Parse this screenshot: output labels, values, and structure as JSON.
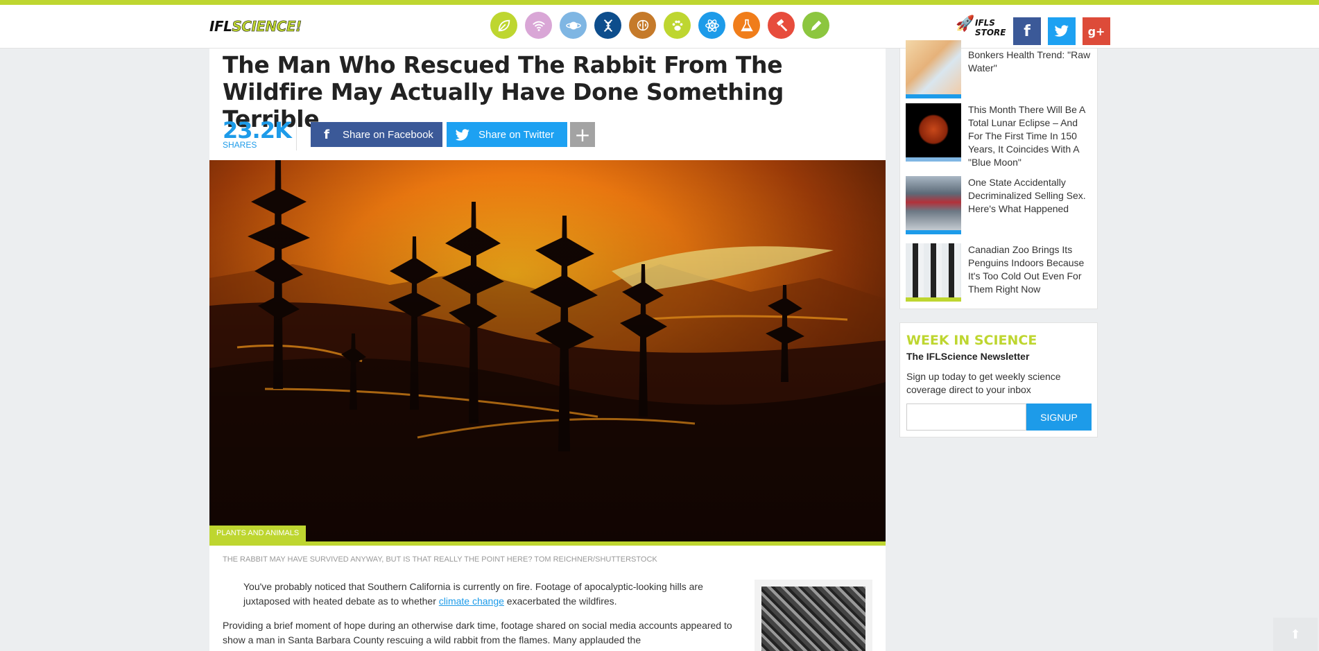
{
  "header": {
    "logo_part1": "IFL",
    "logo_part2": "SCIENCE!",
    "categories": [
      {
        "icon": "leaf-icon",
        "color": "#bed630"
      },
      {
        "icon": "wifi-icon",
        "color": "#d9a6d6"
      },
      {
        "icon": "planet-icon",
        "color": "#7fb6e3"
      },
      {
        "icon": "dna-icon",
        "color": "#0d4d8c"
      },
      {
        "icon": "brain-icon",
        "color": "#c57a2a"
      },
      {
        "icon": "paw-icon",
        "color": "#bed630"
      },
      {
        "icon": "atom-icon",
        "color": "#1d9be9"
      },
      {
        "icon": "flask-icon",
        "color": "#f07d1a"
      },
      {
        "icon": "gavel-icon",
        "color": "#e74c3c"
      },
      {
        "icon": "pencil-icon",
        "color": "#8cc63f"
      }
    ],
    "store_line1": "IFLS",
    "store_line2": "STORE",
    "facebook_glyph": "f",
    "googleplus_glyph": "g+"
  },
  "article": {
    "headline": "The Man Who Rescued The Rabbit From The Wildfire May Actually Have Done Something Terrible",
    "share_count": "23.2K",
    "share_label": "SHARES",
    "share_facebook": "Share on Facebook",
    "share_twitter": "Share on Twitter",
    "facebook_glyph": "f",
    "more_glyph": "+",
    "category_tag": "PLANTS AND ANIMALS",
    "caption": "The rabbit may have survived anyway, but is that really the point here? Tom Reichner/Shutterstock",
    "para1_before": "You've probably noticed that Southern California is currently on fire. Footage of apocalyptic-looking hills are juxtaposed with heated debate as to whether ",
    "para1_link": "climate change",
    "para1_after": " exacerbated the wildfires.",
    "para2": "Providing a brief moment of hope during an otherwise dark time, footage shared on social media accounts appeared to show a man in Santa Barbara County rescuing a wild rabbit from the flames. Many applauded the"
  },
  "sidebar": {
    "stories": [
      {
        "title": "Bonkers Health Trend: \"Raw Water\"",
        "bar": "#1d9be9"
      },
      {
        "title": "This Month There Will Be A Total Lunar Eclipse – And For The First Time In 150 Years, It Coincides With A \"Blue Moon\"",
        "bar": "#7fb6e3"
      },
      {
        "title": "One State Accidentally Decriminalized Selling Sex. Here's What Happened",
        "bar": "#1d9be9"
      },
      {
        "title": "Canadian Zoo Brings Its Penguins Indoors Because It's Too Cold Out Even For Them Right Now",
        "bar": "#bed630"
      }
    ],
    "newsletter": {
      "title": "WEEK IN SCIENCE",
      "subtitle": "The IFLScience Newsletter",
      "description": "Sign up today to get weekly science coverage direct to your inbox",
      "email_placeholder": "",
      "signup_label": "SIGNUP"
    }
  },
  "back_to_top_glyph": "⬆"
}
